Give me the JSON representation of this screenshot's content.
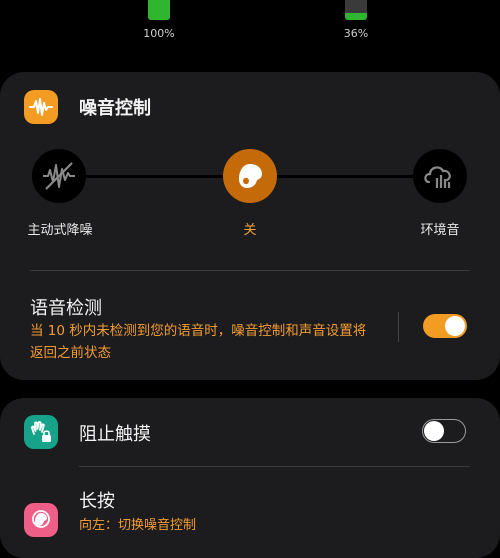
{
  "battery": {
    "left": {
      "percent_text": "100%",
      "level": 1.0
    },
    "right": {
      "percent_text": "36%",
      "level": 0.36
    }
  },
  "noise_control": {
    "title": "噪音控制",
    "icon": "waveform-icon",
    "modes": [
      {
        "label": "主动式降噪",
        "icon": "anc-icon"
      },
      {
        "label": "关",
        "icon": "earbud-icon",
        "selected": true
      },
      {
        "label": "环境音",
        "icon": "ambient-icon"
      }
    ],
    "voice_detect": {
      "title": "语音检测",
      "description": "当 10 秒内未检测到您的语音时，噪音控制和声音设置将返回之前状态",
      "enabled": true
    }
  },
  "touch_block": {
    "title": "阻止触摸",
    "icon": "touch-lock-icon",
    "enabled": false
  },
  "long_press": {
    "title": "长按",
    "subtitle": "向左：切换噪音控制",
    "icon": "long-press-icon"
  },
  "colors": {
    "accent": "#f39c24",
    "card": "#1c1c1e",
    "background": "#000000",
    "teal": "#17a38a",
    "pink": "#ef5e86"
  }
}
